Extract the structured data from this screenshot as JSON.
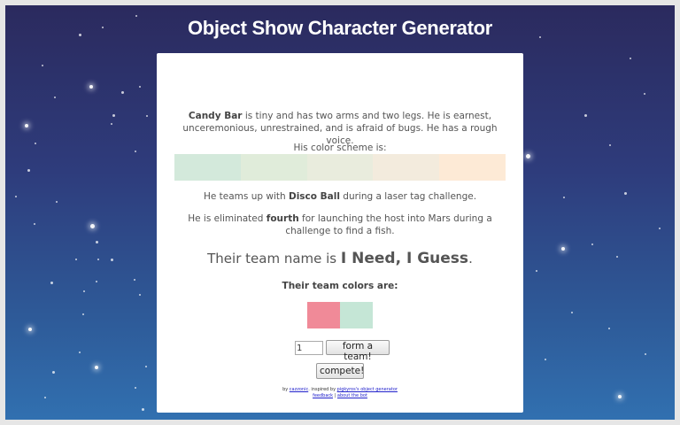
{
  "title": "Object Show Character Generator",
  "character": {
    "name": "Candy Bar",
    "desc_1": "is tiny and has two arms and two legs. He is earnest, unceremonious, unrestrained, and is afraid of bugs. He has a rough voice."
  },
  "scheme": {
    "label": "His color scheme is:",
    "colors": [
      "#d3e9db",
      "#e0ecda",
      "#e9ecdd",
      "#f3ebdd",
      "#fdead6"
    ]
  },
  "teamup": {
    "prefix": "He teams up with",
    "partner": "Disco Ball",
    "suffix": "during a laser tag challenge."
  },
  "elimination": {
    "prefix": "He is eliminated",
    "place": "fourth",
    "suffix": "for launching the host into Mars during a challenge to find a fish."
  },
  "team": {
    "prefix": "Their team name is",
    "name": "I Need, I Guess",
    "suffix": ".",
    "colors_label": "Their team colors are:",
    "colors": [
      "#f08a98",
      "#c5e6d6"
    ]
  },
  "controls": {
    "number_value": "1",
    "form_team_label": "form a team!",
    "compete_label": "compete!"
  },
  "footer": {
    "by": "by",
    "author_link": "cazzonic",
    "inspired_text": ". inspired by",
    "inspired_link": "pigkyros's object generator",
    "feedback_link": "feedback",
    "separator": "|",
    "about_link": "about the bot"
  }
}
